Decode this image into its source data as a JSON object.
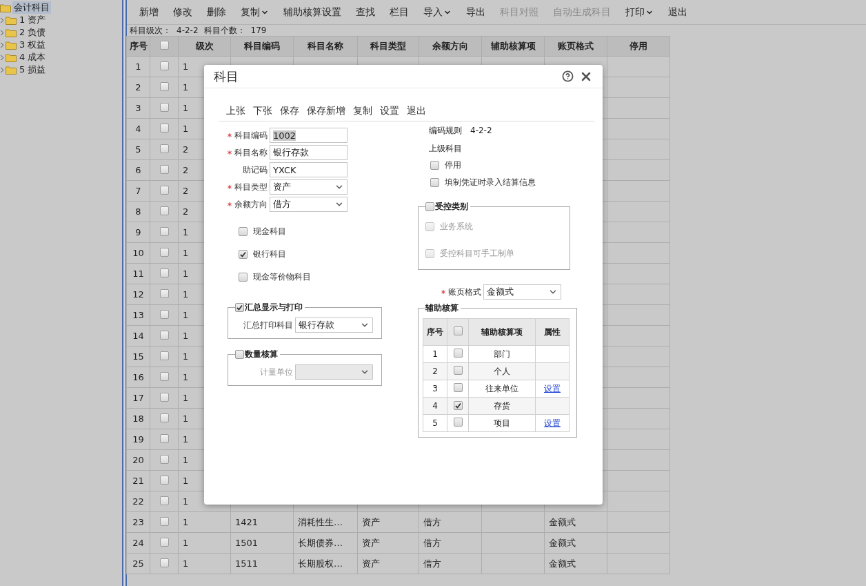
{
  "tree": {
    "root": {
      "label": "会计科目",
      "selected": true
    },
    "children": [
      {
        "label": "1 资产",
        "expanded": false,
        "selected": false
      },
      {
        "label": "2 负债",
        "expanded": false,
        "selected": false
      },
      {
        "label": "3 权益",
        "expanded": false,
        "selected": false
      },
      {
        "label": "4 成本",
        "expanded": false,
        "selected": false
      },
      {
        "label": "5 损益",
        "expanded": false,
        "selected": false
      }
    ]
  },
  "toolbar": [
    {
      "label": "新增",
      "disabled": false,
      "dropdown": false
    },
    {
      "label": "修改",
      "disabled": false,
      "dropdown": false
    },
    {
      "label": "删除",
      "disabled": false,
      "dropdown": false
    },
    {
      "label": "复制",
      "disabled": false,
      "dropdown": true
    },
    {
      "label": "辅助核算设置",
      "disabled": false,
      "dropdown": false
    },
    {
      "label": "查找",
      "disabled": false,
      "dropdown": false
    },
    {
      "label": "栏目",
      "disabled": false,
      "dropdown": false
    },
    {
      "label": "导入",
      "disabled": false,
      "dropdown": true
    },
    {
      "label": "导出",
      "disabled": false,
      "dropdown": false
    },
    {
      "label": "科目对照",
      "disabled": true,
      "dropdown": false
    },
    {
      "label": "自动生成科目",
      "disabled": true,
      "dropdown": false
    },
    {
      "label": "打印",
      "disabled": false,
      "dropdown": true
    },
    {
      "label": "退出",
      "disabled": false,
      "dropdown": false
    }
  ],
  "summary": {
    "level_label": "科目级次：",
    "level_value": "4-2-2",
    "count_label": "科目个数：",
    "count_value": "179"
  },
  "table": {
    "columns": [
      "序号",
      "级次",
      "科目编码",
      "科目名称",
      "科目类型",
      "余额方向",
      "辅助核算项",
      "账页格式",
      "停用"
    ],
    "header_checked": false,
    "rows": [
      {
        "index": "1",
        "checked": false,
        "grade": "1"
      },
      {
        "index": "2",
        "checked": false,
        "grade": "1"
      },
      {
        "index": "3",
        "checked": false,
        "grade": "1"
      },
      {
        "index": "4",
        "checked": false,
        "grade": "1"
      },
      {
        "index": "5",
        "checked": false,
        "grade": "2"
      },
      {
        "index": "6",
        "checked": false,
        "grade": "2"
      },
      {
        "index": "7",
        "checked": false,
        "grade": "2"
      },
      {
        "index": "8",
        "checked": false,
        "grade": "2"
      },
      {
        "index": "9",
        "checked": false,
        "grade": "1"
      },
      {
        "index": "10",
        "checked": false,
        "grade": "1"
      },
      {
        "index": "11",
        "checked": false,
        "grade": "1"
      },
      {
        "index": "12",
        "checked": false,
        "grade": "1"
      },
      {
        "index": "13",
        "checked": false,
        "grade": "1"
      },
      {
        "index": "14",
        "checked": false,
        "grade": "1"
      },
      {
        "index": "15",
        "checked": false,
        "grade": "1"
      },
      {
        "index": "16",
        "checked": false,
        "grade": "1"
      },
      {
        "index": "17",
        "checked": false,
        "grade": "1"
      },
      {
        "index": "18",
        "checked": false,
        "grade": "1"
      },
      {
        "index": "19",
        "checked": false,
        "grade": "1"
      },
      {
        "index": "20",
        "checked": false,
        "grade": "1"
      },
      {
        "index": "21",
        "checked": false,
        "grade": "1"
      },
      {
        "index": "22",
        "checked": false,
        "grade": "1"
      },
      {
        "index": "23",
        "checked": false,
        "grade": "1",
        "code": "1421",
        "name": "消耗性生…",
        "type": "资产",
        "direction": "借方",
        "format": "金额式"
      },
      {
        "index": "24",
        "checked": false,
        "grade": "1",
        "code": "1501",
        "name": "长期债券…",
        "type": "资产",
        "direction": "借方",
        "format": "金额式"
      },
      {
        "index": "25",
        "checked": false,
        "grade": "1",
        "code": "1511",
        "name": "长期股权…",
        "type": "资产",
        "direction": "借方",
        "format": "金额式"
      }
    ]
  },
  "dialog": {
    "title": "科目",
    "toolbar": [
      "上张",
      "下张",
      "保存",
      "保存新增",
      "复制",
      "设置",
      "退出"
    ],
    "fields": [
      {
        "kind": "input",
        "label": "科目编码",
        "required": true,
        "value": "1002",
        "highlighted": true
      },
      {
        "kind": "input",
        "label": "科目名称",
        "required": true,
        "value": "银行存款",
        "highlighted": false
      },
      {
        "kind": "input",
        "label": "助记码",
        "required": false,
        "value": "YXCK",
        "highlighted": false
      },
      {
        "kind": "select",
        "label": "科目类型",
        "required": true,
        "value": "资产",
        "highlighted": false
      },
      {
        "kind": "select",
        "label": "余额方向",
        "required": true,
        "value": "借方",
        "highlighted": false
      }
    ],
    "options": [
      {
        "label": "现金科目",
        "checked": false
      },
      {
        "label": "银行科目",
        "checked": true
      },
      {
        "label": "现金等价物科目",
        "checked": false
      }
    ],
    "summary_print": {
      "legend": "汇总显示与打印",
      "checked": true,
      "label": "汇总打印科目",
      "value": "银行存款",
      "disabled": false
    },
    "quantity": {
      "legend": "数量核算",
      "checked": false,
      "label": "计量单位",
      "disabled": true
    },
    "coding_rule": {
      "label": "编码规则",
      "value": "4-2-2"
    },
    "parent_label": "上级科目",
    "flags": [
      {
        "label": "停用",
        "checked": false
      },
      {
        "label": "填制凭证时录入结算信息",
        "checked": false
      }
    ],
    "controlled": {
      "legend": "受控类别",
      "checked": false,
      "items": [
        {
          "label": "业务系统",
          "checked": false,
          "disabled": true
        },
        {
          "label": "受控科目可手工制单",
          "checked": false,
          "disabled": true
        }
      ]
    },
    "ledger_format": {
      "label": "账页格式",
      "required": true,
      "value": "金额式"
    },
    "aux": {
      "legend": "辅助核算",
      "columns": [
        "序号",
        "辅助核算项",
        "属性"
      ],
      "header_checked": false,
      "rows": [
        {
          "index": "1",
          "checked": false,
          "name": "部门"
        },
        {
          "index": "2",
          "checked": false,
          "name": "个人"
        },
        {
          "index": "3",
          "checked": false,
          "name": "往来单位",
          "link": "设置"
        },
        {
          "index": "4",
          "checked": true,
          "name": "存货"
        },
        {
          "index": "5",
          "checked": false,
          "name": "项目",
          "link": "设置"
        }
      ]
    }
  }
}
